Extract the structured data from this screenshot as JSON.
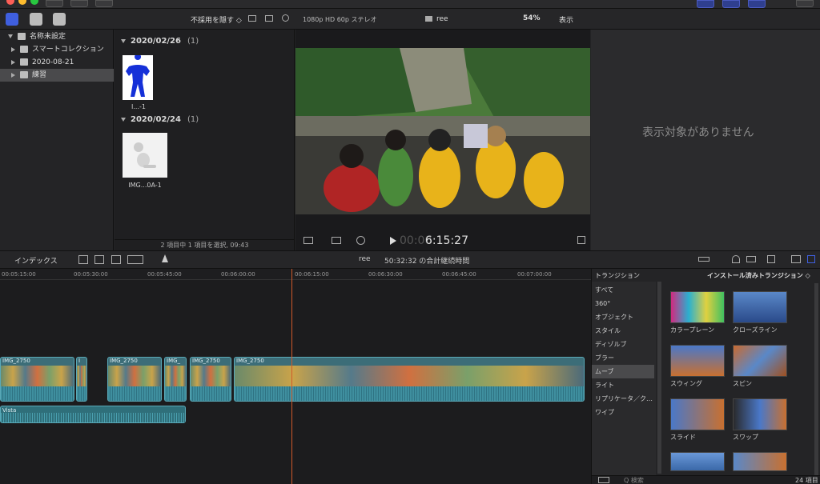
{
  "toolbar": {
    "hide_rejected": "不採用を隠す ◇",
    "format": "1080p HD 60p ステレオ",
    "project_name": "ree",
    "zoom": "54%",
    "view": "表示"
  },
  "library": {
    "items": [
      {
        "label": "名称未設定",
        "expanded": true
      },
      {
        "label": "スマートコレクション",
        "expanded": false
      },
      {
        "label": "2020-08-21",
        "expanded": false
      },
      {
        "label": "練習",
        "expanded": false,
        "selected": true
      }
    ]
  },
  "browser": {
    "groups": [
      {
        "date": "2020/02/26",
        "count": "(1)",
        "clip_caption": "I...-1"
      },
      {
        "date": "2020/02/24",
        "count": "(1)",
        "clip_caption": "IMG...0A-1"
      }
    ],
    "status": "2 項目中 1 項目を選択, 09:43"
  },
  "viewer": {
    "timecode_dim": "00:00",
    "timecode": "6:15:27"
  },
  "inspector": {
    "empty_message": "表示対象がありません"
  },
  "timeline": {
    "index_label": "インデックス",
    "project": "ree",
    "duration": "50:32:32 の合計継続時間",
    "ruler": [
      "00:05:15:00",
      "00:05:30:00",
      "00:05:45:00",
      "00:06:00:00",
      "00:06:15:00",
      "00:06:30:00",
      "00:06:45:00",
      "00:07:00:00"
    ],
    "clips": [
      "IMG_2750",
      "I",
      "IMG_2750",
      "IMG_",
      "IMG_2750",
      "IMG_2750"
    ],
    "audio_clip": "Vista"
  },
  "transitions": {
    "header": "トランジション",
    "installed": "インストール済みトランジション ◇",
    "categories": [
      "すべて",
      "360°",
      "オブジェクト",
      "スタイル",
      "ディゾルブ",
      "ブラー",
      "ムーブ",
      "ライト",
      "リプリケータ／ク…",
      "ワイプ"
    ],
    "selected_category": "ムーブ",
    "tiles": [
      "カラープレーン",
      "クローズライン",
      "スウィング",
      "スピン",
      "スライド",
      "スワップ",
      "",
      ""
    ],
    "search_placeholder": "Q 検索",
    "count": "24 項目"
  },
  "colors": {
    "accent": "#3f5fdf",
    "playhead": "#d05a2a",
    "clip": "#3c6d78"
  }
}
